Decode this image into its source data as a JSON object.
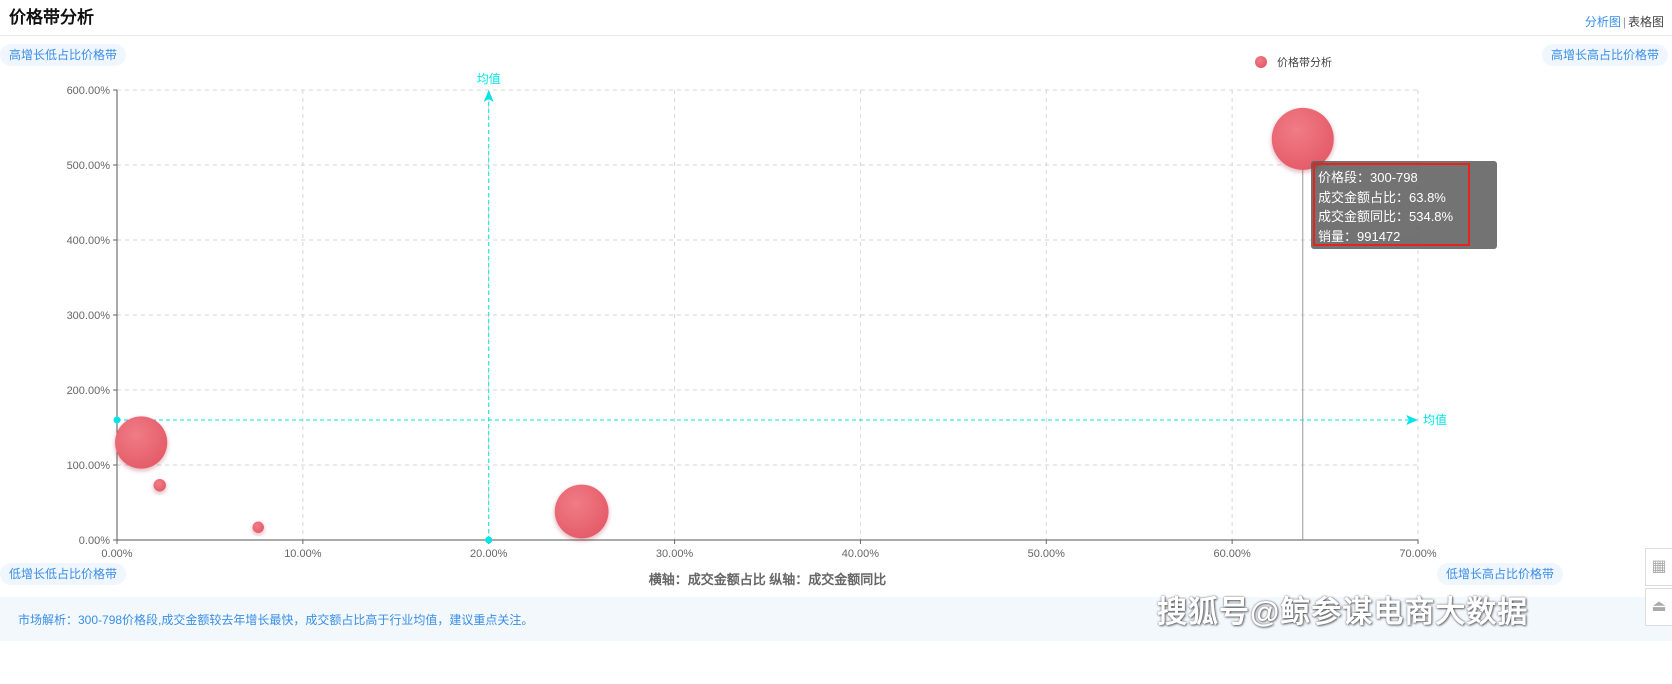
{
  "header": {
    "title": "价格带分析",
    "view_analysis": "分析图",
    "view_separator": "|",
    "view_table": "表格图"
  },
  "quadrants": {
    "top_left": "高增长低占比价格带",
    "top_right": "高增长高占比价格带",
    "bottom_left": "低增长低占比价格带",
    "bottom_right": "低增长高占比价格带"
  },
  "tooltip": {
    "line1": "价格段：300-798",
    "line2": "成交金额占比：63.8%",
    "line3": "成交金额同比：534.8%",
    "line4": "销量：991472"
  },
  "footer": {
    "analysis": "市场解析：300-798价格段,成交金额较去年增长最快，成交额占比高于行业均值，建议重点关注。"
  },
  "watermark": "搜狐号@鲸参谋电商大数据",
  "colors": {
    "accent": "#3a8ee6",
    "bubble": "#e45a67",
    "mean_line": "#00e5e5",
    "tooltip_border": "#e8231b"
  },
  "chart_data": {
    "type": "scatter",
    "xlabel": "横轴：成交金额占比",
    "ylabel": "纵轴：成交金额同比",
    "axis_caption": "横轴：成交金额占比  纵轴：成交金额同比",
    "xlim": [
      0,
      70
    ],
    "ylim": [
      0,
      600
    ],
    "x_ticks": [
      "0.00%",
      "10.00%",
      "20.00%",
      "30.00%",
      "40.00%",
      "50.00%",
      "60.00%",
      "70.00%"
    ],
    "y_ticks": [
      "0.00%",
      "100.00%",
      "200.00%",
      "300.00%",
      "400.00%",
      "500.00%",
      "600.00%"
    ],
    "grid": true,
    "legend": {
      "position": "top-right",
      "entries": [
        "价格带分析"
      ]
    },
    "series": [
      {
        "name": "价格带分析",
        "points": [
          {
            "x": 63.8,
            "y": 534.8,
            "size": 991472,
            "label": "300-798"
          },
          {
            "x": 25.0,
            "y": 38,
            "size": 880000
          },
          {
            "x": 1.3,
            "y": 130,
            "size": 860000
          },
          {
            "x": 2.3,
            "y": 73,
            "size": 260000
          },
          {
            "x": 7.6,
            "y": 17,
            "size": 240000
          }
        ]
      }
    ],
    "mean_lines": {
      "label": "均值",
      "x": 20.0,
      "y": 160
    },
    "highlight_x": 63.8
  }
}
